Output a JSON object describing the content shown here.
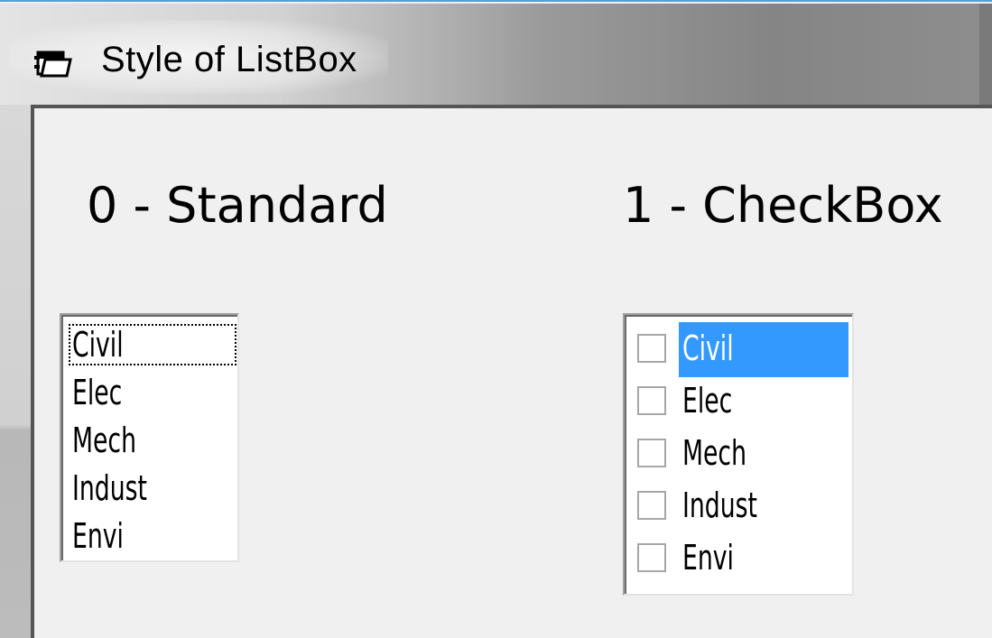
{
  "window": {
    "title": "Style of ListBox"
  },
  "headings": {
    "standard": "0 - Standard",
    "checkbox": "1 - CheckBox"
  },
  "standard_list": {
    "items": [
      "Civil",
      "Elec",
      "Mech",
      "Indust",
      "Envi"
    ],
    "focused_index": 0
  },
  "checkbox_list": {
    "items": [
      {
        "label": "Civil",
        "checked": false,
        "selected": true
      },
      {
        "label": "Elec",
        "checked": false,
        "selected": false
      },
      {
        "label": "Mech",
        "checked": false,
        "selected": false
      },
      {
        "label": "Indust",
        "checked": false,
        "selected": false
      },
      {
        "label": "Envi",
        "checked": false,
        "selected": false
      }
    ]
  },
  "colors": {
    "selection": "#3399ff",
    "window_background": "#f0f0f0",
    "titlebar_accent": "#5a9fd4"
  },
  "icons": {
    "app_icon": "window-app-icon"
  }
}
